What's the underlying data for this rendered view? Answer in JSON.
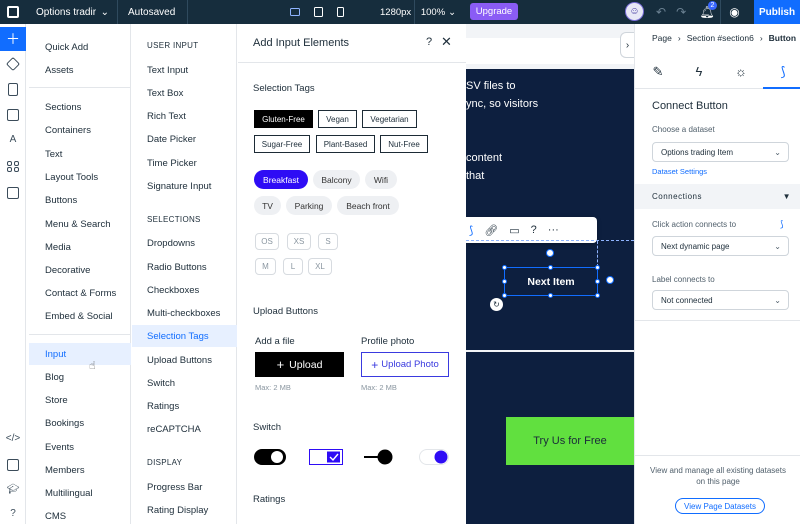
{
  "topbar": {
    "site_name": "Options tradir",
    "autosave": "Autosaved",
    "resolution": "1280px",
    "zoom": "100%",
    "upgrade": "Upgrade",
    "notifications": "2",
    "publish": "Publish"
  },
  "categories": [
    "Quick Add",
    "Assets",
    "Sections",
    "Containers",
    "Text",
    "Layout Tools",
    "Buttons",
    "Menu & Search",
    "Media",
    "Decorative",
    "Contact & Forms",
    "Embed & Social",
    "Input",
    "Blog",
    "Store",
    "Bookings",
    "Events",
    "Members",
    "Multilingual",
    "CMS"
  ],
  "subcategories": {
    "user_input_header": "USER INPUT",
    "user_input": [
      "Text Input",
      "Text Box",
      "Rich Text",
      "Date Picker",
      "Time Picker",
      "Signature Input"
    ],
    "selections_header": "SELECTIONS",
    "selections": [
      "Dropdowns",
      "Radio Buttons",
      "Checkboxes",
      "Multi-checkboxes",
      "Selection Tags",
      "Upload Buttons",
      "Switch",
      "Ratings",
      "reCAPTCHA"
    ],
    "display_header": "DISPLAY",
    "display": [
      "Progress Bar",
      "Rating Display"
    ]
  },
  "panel": {
    "title": "Add Input Elements",
    "help": "?",
    "close": "✕",
    "selection_tags_label": "Selection Tags",
    "tags_row1": [
      "Gluten-Free",
      "Vegan",
      "Vegetarian"
    ],
    "tags_row2": [
      "Sugar-Free",
      "Plant-Based",
      "Nut-Free"
    ],
    "pills_row1": [
      "Breakfast",
      "Balcony",
      "Wifi"
    ],
    "pills_row2": [
      "TV",
      "Parking",
      "Beach front"
    ],
    "ghost_row1": [
      "OS",
      "XS",
      "S"
    ],
    "ghost_row2": [
      "M",
      "L",
      "XL"
    ],
    "upload_label": "Upload Buttons",
    "add_file": "Add a file",
    "profile_photo": "Profile photo",
    "upload_btn": "Upload",
    "upload_photo_btn": "Upload Photo",
    "max_size_1": "Max: 2 MB",
    "max_size_2": "Max: 2 MB",
    "switch_label": "Switch",
    "ratings_label": "Ratings"
  },
  "canvas": {
    "text_line1": "SV files to",
    "text_line2": "ync, so visitors",
    "text_line3": "content",
    "text_line4": "that",
    "next_item": "Next Item",
    "try_us": "Try Us for Free"
  },
  "inspector": {
    "crumbs": [
      "Page",
      "›",
      "Section #section6",
      "›",
      "Button"
    ],
    "title": "Connect Button",
    "dataset_label": "Choose a dataset",
    "dataset_value": "Options trading Item",
    "dataset_settings": "Dataset Settings",
    "connections": "Connections",
    "click_label": "Click action connects to",
    "click_value": "Next dynamic page",
    "label_label": "Label connects to",
    "label_value": "Not connected",
    "footer_text": "View and manage all existing datasets on this page",
    "footer_btn": "View Page Datasets"
  },
  "colors": {
    "brand_blue": "#116dff",
    "topbar_bg": "#162d3d",
    "upgrade": "#8a5cf5",
    "canvas_section": "#0d1f3f",
    "cta_green": "#61e03f",
    "pill_active": "#2e0cf5"
  }
}
